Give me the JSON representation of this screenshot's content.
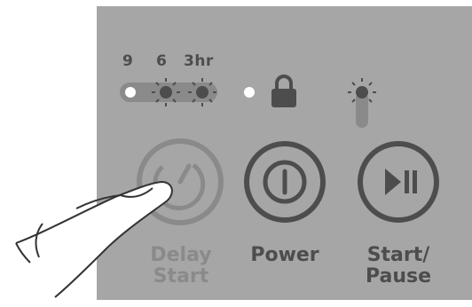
{
  "delay_indicators": {
    "hour_labels": [
      "9",
      "6",
      "3hr"
    ],
    "active_hours": [
      "6",
      "3hr"
    ]
  },
  "lock_indicator": {
    "icon": "lock-icon"
  },
  "start_indicator": {
    "icon": "led-indicator-icon"
  },
  "buttons": {
    "delay_start": {
      "label_line1": "Delay",
      "label_line2": "Start",
      "icon": "delay-timer-icon",
      "state": "pressed"
    },
    "power": {
      "label": "Power",
      "icon": "power-icon"
    },
    "start_pause": {
      "label_line1": "Start/",
      "label_line2": "Pause",
      "icon": "play-pause-icon"
    }
  },
  "colors": {
    "panel": "#a6a6a6",
    "dark": "#4d4d4d",
    "muted": "#8a8a8a",
    "led_on": "#ffffff"
  }
}
